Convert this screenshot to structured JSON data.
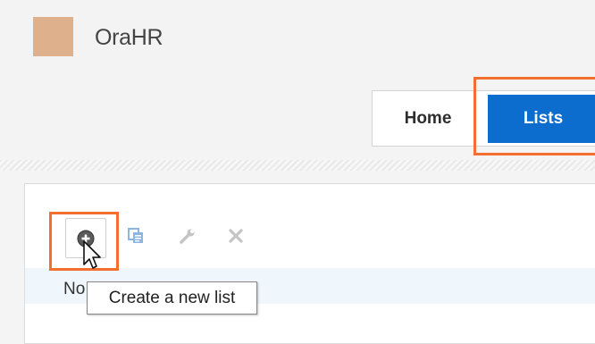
{
  "app": {
    "title": "OraHR",
    "logo_color": "#dfb08c"
  },
  "tabs": {
    "home_label": "Home",
    "lists_label": "Lists",
    "active": "Lists",
    "active_color": "#0c6dce"
  },
  "toolbar": {
    "create_icon": "add-circle-icon",
    "copy_icon": "copy-icon",
    "edit_icon": "wrench-icon",
    "delete_icon": "close-icon"
  },
  "list": {
    "row_text": "No"
  },
  "tooltip": {
    "text": "Create a new list"
  },
  "highlight_color": "#f26f2f"
}
